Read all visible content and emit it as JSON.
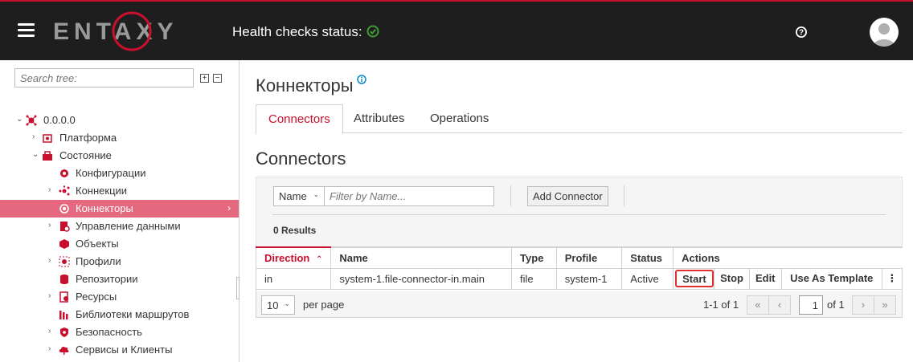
{
  "header": {
    "logo_text": "ENTAXY",
    "health_label": "Health checks status:",
    "health_state": "ok",
    "colors": {
      "bar": "#1e1e1e",
      "accent": "#c8102e",
      "ok": "#3f9c35"
    }
  },
  "sidebar": {
    "search_placeholder": "Search tree:",
    "expand_all": "⊞",
    "collapse_all": "⊟",
    "items": [
      {
        "label": "0.0.0.0",
        "chevron": "⌄",
        "icon": "network-icon"
      },
      {
        "label": "Платформа",
        "chevron": "›",
        "icon": "platform-icon"
      },
      {
        "label": "Состояние",
        "chevron": "⌄",
        "icon": "state-icon"
      },
      {
        "label": "Конфигурации",
        "chevron": "",
        "icon": "config-icon"
      },
      {
        "label": "Коннекции",
        "chevron": "›",
        "icon": "connections-icon"
      },
      {
        "label": "Коннекторы",
        "chevron": "",
        "icon": "connectors-icon",
        "selected": true
      },
      {
        "label": "Управление данными",
        "chevron": "›",
        "icon": "data-management-icon"
      },
      {
        "label": "Объекты",
        "chevron": "",
        "icon": "objects-icon"
      },
      {
        "label": "Профили",
        "chevron": "›",
        "icon": "profiles-icon"
      },
      {
        "label": "Репозитории",
        "chevron": "",
        "icon": "repositories-icon"
      },
      {
        "label": "Ресурсы",
        "chevron": "›",
        "icon": "resources-icon"
      },
      {
        "label": "Библиотеки маршрутов",
        "chevron": "",
        "icon": "route-libraries-icon"
      },
      {
        "label": "Безопасность",
        "chevron": "›",
        "icon": "security-icon"
      },
      {
        "label": "Сервисы и Клиенты",
        "chevron": "›",
        "icon": "services-icon"
      }
    ]
  },
  "main": {
    "title": "Коннекторы",
    "tabs": [
      {
        "label": "Connectors",
        "active": true
      },
      {
        "label": "Attributes",
        "active": false
      },
      {
        "label": "Operations",
        "active": false
      }
    ],
    "section_title": "Connectors",
    "toolbar": {
      "filter_field": "Name",
      "filter_placeholder": "Filter by Name...",
      "add_button": "Add Connector",
      "results": "0 Results"
    },
    "table": {
      "columns": [
        "Direction",
        "Name",
        "Type",
        "Profile",
        "Status",
        "Actions"
      ],
      "sorted_column": "Direction",
      "sort_indicator": "⌃",
      "rows": [
        {
          "direction": "in",
          "name": "system-1.file-connector-in.main",
          "type": "file",
          "profile": "system-1",
          "status": "Active"
        }
      ],
      "row_actions": [
        "Start",
        "Stop",
        "Edit",
        "Use As Template"
      ],
      "kebab": "⋮"
    },
    "pagination": {
      "per_page": "10",
      "per_page_label": "per page",
      "range": "1-1 of 1",
      "page": "1",
      "of_pages": "of 1",
      "first": "«",
      "prev": "‹",
      "next": "›",
      "last": "»"
    }
  }
}
